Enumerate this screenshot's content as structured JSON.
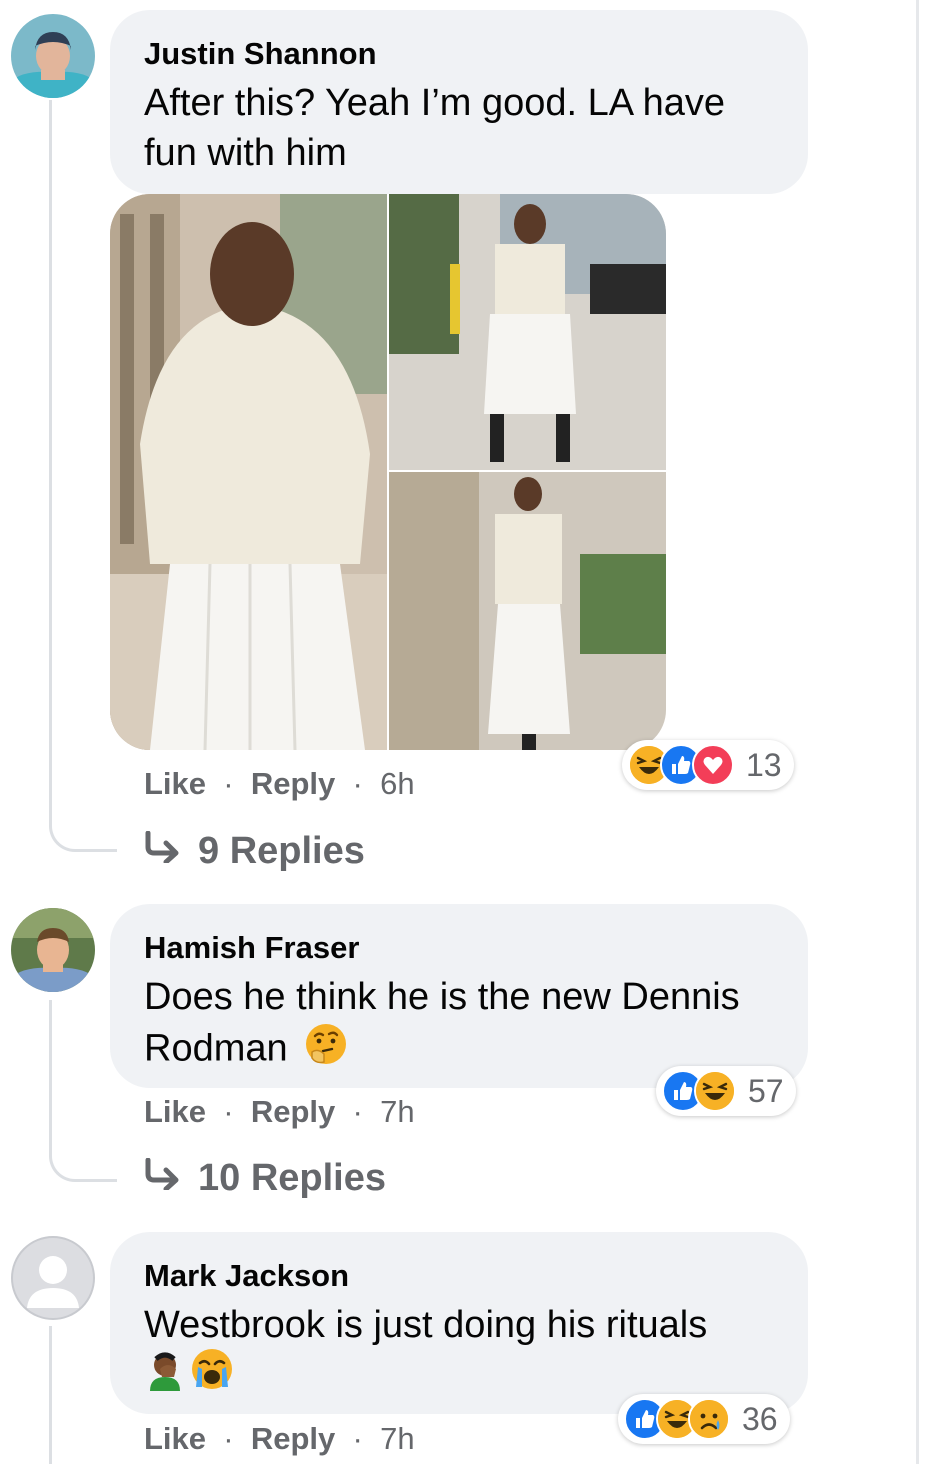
{
  "comments": [
    {
      "author": "Justin Shannon",
      "text_line1": "After this? Yeah I’m good. LA have",
      "text_line2": "fun with him",
      "actions": {
        "like": "Like",
        "reply": "Reply",
        "sep": "·",
        "time": "6h"
      },
      "replies": "9 Replies",
      "reactions": {
        "icons": [
          "haha-icon",
          "like-icon",
          "love-icon"
        ],
        "count": "13"
      }
    },
    {
      "author": "Hamish Fraser",
      "text_line1": "Does he think he is the new Dennis",
      "text_line2": "Rodman",
      "emoji": "thinking-face-icon",
      "actions": {
        "like": "Like",
        "reply": "Reply",
        "sep": "·",
        "time": "7h"
      },
      "replies": "10 Replies",
      "reactions": {
        "icons": [
          "like-icon",
          "haha-icon"
        ],
        "count": "57"
      }
    },
    {
      "author": "Mark Jackson",
      "text_line1": "Westbrook is just doing his rituals",
      "emojis": [
        "facepalm-icon",
        "crying-face-icon"
      ],
      "actions": {
        "like": "Like",
        "reply": "Reply",
        "sep": "·",
        "time": "7h"
      },
      "reactions": {
        "icons": [
          "like-icon",
          "haha-icon",
          "sad-icon"
        ],
        "count": "36"
      }
    }
  ],
  "colors": {
    "like_blue": "#1877f2",
    "love_red": "#f33e58",
    "haha_yellow": "#f7b125",
    "bubble_gray": "#f0f2f5",
    "meta_gray": "#65676b"
  }
}
